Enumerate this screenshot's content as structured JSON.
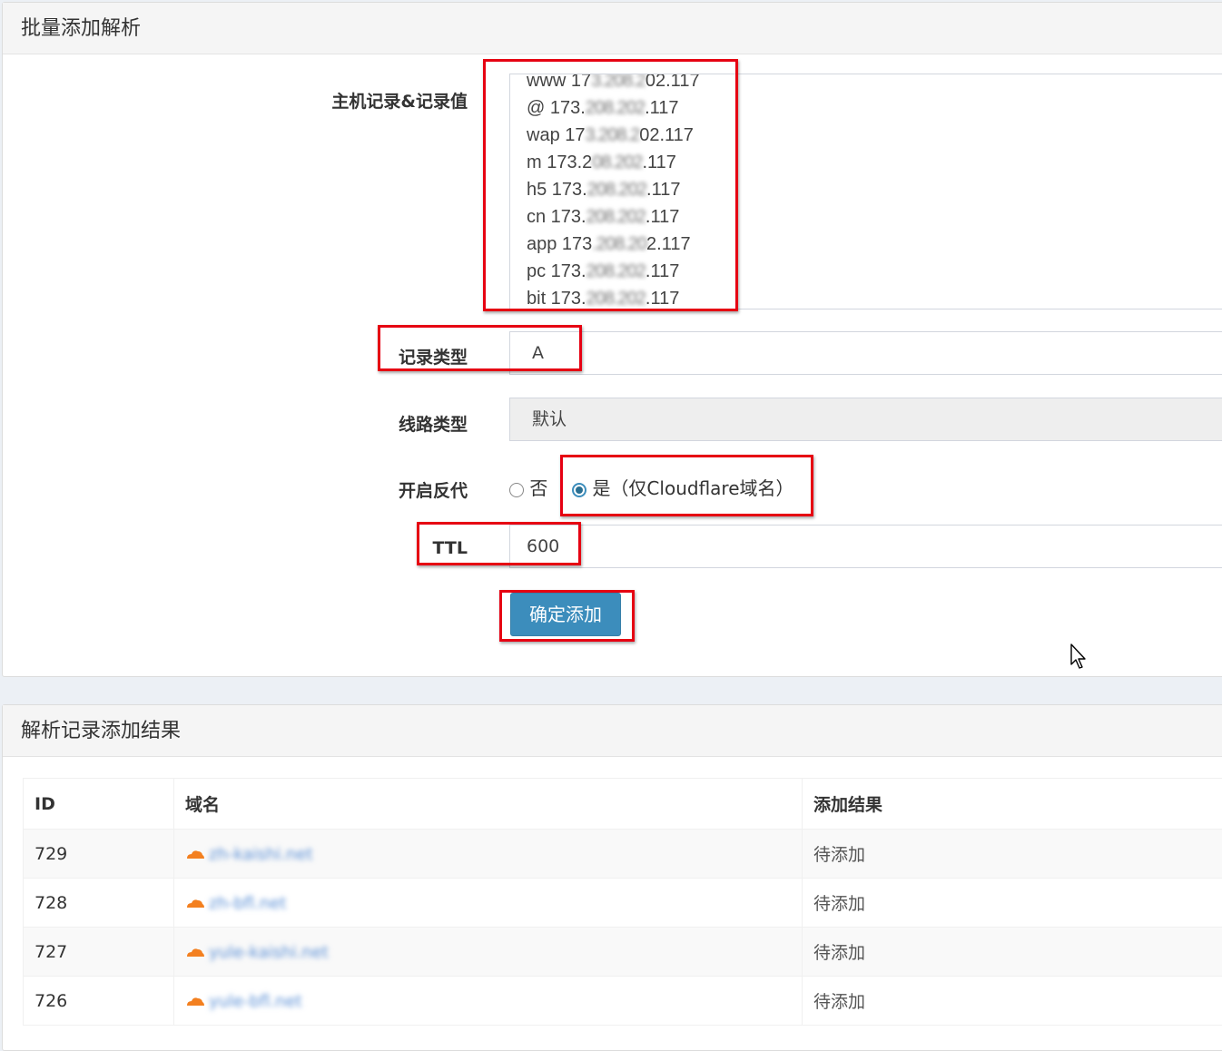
{
  "batch_panel": {
    "title": "批量添加解析",
    "host_label": "主机记录&记录值",
    "records": [
      {
        "prefix": "www 17",
        "masked": "3.208.2",
        "suffix": "02.117"
      },
      {
        "prefix": "@ 173.",
        "masked": "208.202",
        "suffix": ".117"
      },
      {
        "prefix": "wap 17",
        "masked": "3.208.2",
        "suffix": "02.117"
      },
      {
        "prefix": "m 173.2",
        "masked": "08.202",
        "suffix": ".117"
      },
      {
        "prefix": "h5 173.",
        "masked": "208.202",
        "suffix": ".117"
      },
      {
        "prefix": "cn 173.",
        "masked": "208.202",
        "suffix": ".117"
      },
      {
        "prefix": "app 173",
        "masked": ".208.20",
        "suffix": "2.117"
      },
      {
        "prefix": "pc 173.",
        "masked": "208.202",
        "suffix": ".117"
      },
      {
        "prefix": "bit 173.",
        "masked": "208.202",
        "suffix": ".117"
      }
    ],
    "record_type_label": "记录类型",
    "record_type_value": "A",
    "line_type_label": "线路类型",
    "line_type_value": "默认",
    "proxy_label": "开启反代",
    "proxy_no": "否",
    "proxy_yes": "是（仅Cloudflare域名）",
    "ttl_label": "TTL",
    "ttl_value": "600",
    "submit_label": "确定添加"
  },
  "results_panel": {
    "title": "解析记录添加结果",
    "columns": [
      "ID",
      "域名",
      "添加结果"
    ],
    "rows": [
      {
        "id": "729",
        "domain": "zh-kaishi.net",
        "status": "待添加"
      },
      {
        "id": "728",
        "domain": "zh-bfl.net",
        "status": "待添加"
      },
      {
        "id": "727",
        "domain": "yule-kaishi.net",
        "status": "待添加"
      },
      {
        "id": "726",
        "domain": "yule-bfl.net",
        "status": "待添加"
      }
    ]
  },
  "colors": {
    "primary": "#3c8dbc",
    "highlight": "#e60012",
    "cloudflare": "#f38020"
  },
  "icons": [
    "cloudflare-icon",
    "mouse-cursor-icon"
  ]
}
